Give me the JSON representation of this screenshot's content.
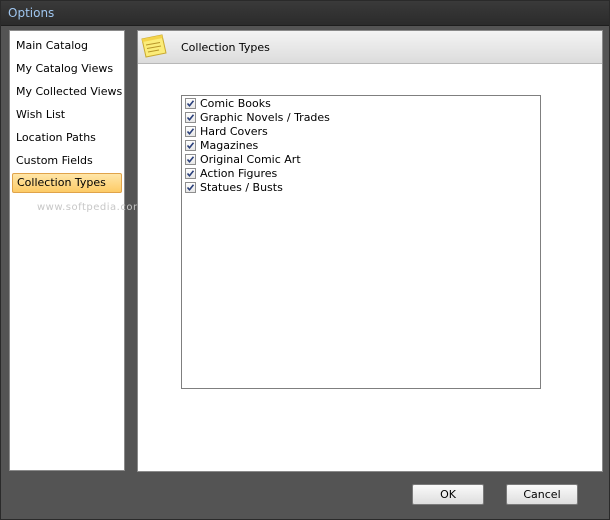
{
  "window": {
    "title": "Options"
  },
  "sidebar": {
    "items": [
      {
        "label": "Main Catalog"
      },
      {
        "label": "My Catalog Views"
      },
      {
        "label": "My Collected Views"
      },
      {
        "label": "Wish List"
      },
      {
        "label": "Location Paths"
      },
      {
        "label": "Custom Fields"
      },
      {
        "label": "Collection Types",
        "selected": true
      }
    ],
    "watermark": "www.softpedia.com"
  },
  "panel": {
    "title": "Collection Types",
    "icon": "note-icon",
    "items": [
      {
        "label": "Comic Books",
        "checked": true
      },
      {
        "label": "Graphic Novels / Trades",
        "checked": true
      },
      {
        "label": "Hard Covers",
        "checked": true
      },
      {
        "label": "Magazines",
        "checked": true
      },
      {
        "label": "Original Comic Art",
        "checked": true
      },
      {
        "label": "Action Figures",
        "checked": true
      },
      {
        "label": "Statues / Busts",
        "checked": true
      }
    ]
  },
  "buttons": {
    "ok": "OK",
    "cancel": "Cancel"
  },
  "colors": {
    "title_text": "#9fc6ef",
    "selection": "#fdcb66",
    "window_bg": "#545454"
  }
}
